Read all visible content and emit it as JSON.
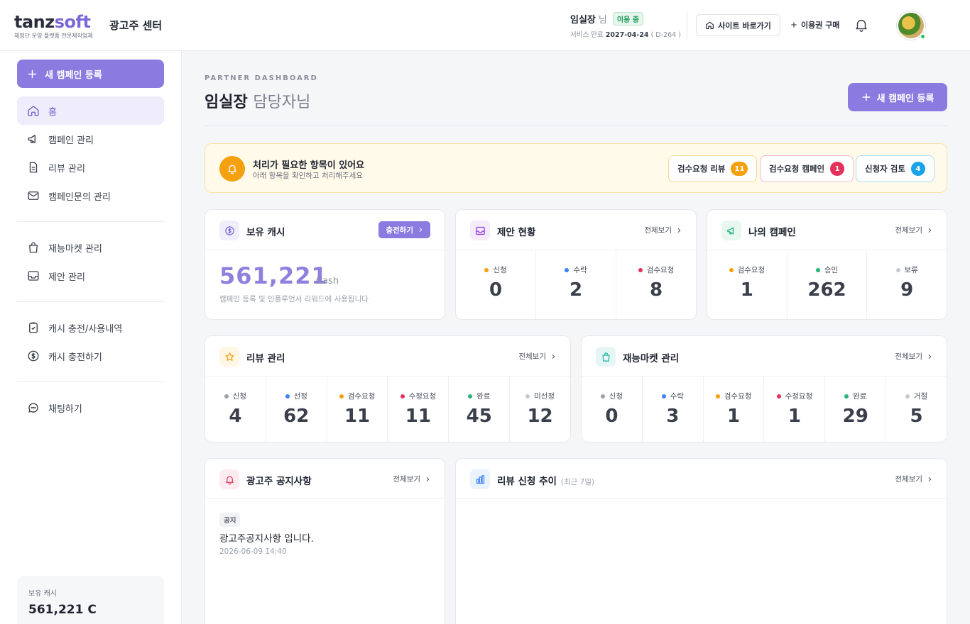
{
  "header": {
    "logo_main": "tanz",
    "logo_accent": "soft",
    "logo_sub": "체험단 운영 플랫폼 전문제작업체",
    "center_title": "광고주 센터",
    "user_name": "임실장",
    "user_suffix": "님",
    "status": "이용 중",
    "expiry_label": "서비스 만료",
    "expiry_date": "2027-04-24",
    "expiry_dday": "( D-264 )",
    "site_button": "사이트 바로가기",
    "buy_link": "이용권 구매"
  },
  "sidebar": {
    "new_campaign": "새 캠페인 등록",
    "items": [
      {
        "label": "홈",
        "icon": "home-icon"
      },
      {
        "label": "캠페인 관리",
        "icon": "megaphone-icon"
      },
      {
        "label": "리뷰 관리",
        "icon": "document-icon"
      },
      {
        "label": "캠페인문의 관리",
        "icon": "mail-icon"
      },
      {
        "label": "재능마켓 관리",
        "icon": "shopping-bag-icon"
      },
      {
        "label": "제안 관리",
        "icon": "inbox-icon"
      },
      {
        "label": "캐시 충전/사용내역",
        "icon": "clipboard-icon"
      },
      {
        "label": "캐시 충전하기",
        "icon": "dollar-icon"
      },
      {
        "label": "채팅하기",
        "icon": "chat-icon"
      }
    ],
    "cash_label": "보유 캐시",
    "cash_value": "561,221 C"
  },
  "main": {
    "eyebrow": "PARTNER DASHBOARD",
    "title_name": "임실장",
    "title_role": "담당자님",
    "new_campaign": "새 캠페인 등록",
    "more_label": "전체보기"
  },
  "alert": {
    "title": "처리가 필요한 항목이 있어요",
    "subtitle": "아래 항목을 확인하고 처리해주세요",
    "pills": [
      {
        "label": "검수요청 리뷰",
        "count": "11",
        "color": "#f5a00f"
      },
      {
        "label": "검수요청 캠페인",
        "count": "1",
        "color": "#e5305a"
      },
      {
        "label": "신청자 검토",
        "count": "4",
        "color": "#1aa3e8"
      }
    ]
  },
  "cash_card": {
    "title": "보유 캐시",
    "charge_button": "충전하기",
    "value": "561,221",
    "unit": "Cash",
    "description": "캠페인 등록 및 인플루언서 리워드에 사용됩니다"
  },
  "proposal_card": {
    "title": "제안 현황",
    "stats": [
      {
        "label": "신청",
        "value": "0",
        "color": "#f5a00f"
      },
      {
        "label": "수락",
        "value": "2",
        "color": "#3b82f6"
      },
      {
        "label": "검수요청",
        "value": "8",
        "color": "#e5305a"
      }
    ]
  },
  "campaign_card": {
    "title": "나의 캠페인",
    "stats": [
      {
        "label": "검수요청",
        "value": "1",
        "color": "#f5a00f"
      },
      {
        "label": "승인",
        "value": "262",
        "color": "#22b573"
      },
      {
        "label": "보류",
        "value": "9",
        "color": "#c5c9d2"
      }
    ]
  },
  "review_card": {
    "title": "리뷰 관리",
    "stats": [
      {
        "label": "신청",
        "value": "4",
        "color": "#9aa0ab"
      },
      {
        "label": "선정",
        "value": "62",
        "color": "#3b82f6"
      },
      {
        "label": "검수요청",
        "value": "11",
        "color": "#f5a00f"
      },
      {
        "label": "수정요청",
        "value": "11",
        "color": "#e5305a"
      },
      {
        "label": "완료",
        "value": "45",
        "color": "#22b573"
      },
      {
        "label": "미선정",
        "value": "12",
        "color": "#c5c9d2"
      }
    ]
  },
  "market_card": {
    "title": "재능마켓 관리",
    "stats": [
      {
        "label": "신청",
        "value": "0",
        "color": "#9aa0ab"
      },
      {
        "label": "수락",
        "value": "3",
        "color": "#3b82f6"
      },
      {
        "label": "검수요청",
        "value": "1",
        "color": "#f5a00f"
      },
      {
        "label": "수정요청",
        "value": "1",
        "color": "#e5305a"
      },
      {
        "label": "완료",
        "value": "29",
        "color": "#22b573"
      },
      {
        "label": "거절",
        "value": "5",
        "color": "#c5c9d2"
      }
    ]
  },
  "notice_card": {
    "title": "광고주 공지사항",
    "tag": "공지",
    "item_title": "광고주공지사항 입니다.",
    "item_date": "2026-06-09 14:40"
  },
  "trend_card": {
    "title": "리뷰 신청 추이",
    "hint": "(최근 7일)"
  },
  "colors": {
    "accent": "#8b7ae0",
    "accent_soft": "#efecfb"
  }
}
